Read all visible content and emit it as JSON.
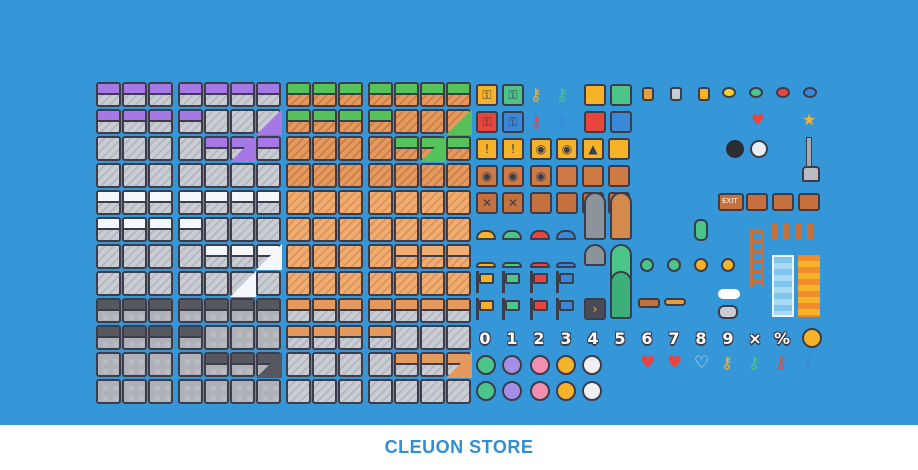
{
  "footer": {
    "store_name": "CLEUON STORE"
  },
  "colors": {
    "background": "#3596d8",
    "outline": "#3c3c4a",
    "purple_cap": "#a678e6",
    "grass": "#55c25a",
    "snow": "#f4f7fb",
    "stone": "#c9ccd2",
    "dirt": "#e49a5e",
    "brand_text": "#2f8fd0"
  },
  "numbers": [
    "0",
    "1",
    "2",
    "3",
    "4",
    "5",
    "6",
    "7",
    "8",
    "9",
    "×",
    "%"
  ],
  "tilesets": [
    {
      "name": "purple-stone-terrain",
      "icon": "purple-stone-tile"
    },
    {
      "name": "grass-dirt-terrain",
      "icon": "grass-dirt-tile"
    },
    {
      "name": "snow-stone-terrain",
      "icon": "snow-stone-tile"
    },
    {
      "name": "cobble-stone-terrain",
      "icon": "cobble-tile"
    }
  ],
  "items": {
    "blocks": [
      "keyhole-block-yellow",
      "keyhole-block-green",
      "key-yellow",
      "key-green",
      "question-block-yellow",
      "block-green",
      "keyhole-block-red",
      "keyhole-block-blue",
      "key-red",
      "key-blue",
      "block-red",
      "block-blue"
    ],
    "collectibles": [
      "gem-orange",
      "gem-silver",
      "gem-gold",
      "balloon-yellow",
      "balloon-green",
      "balloon-red",
      "balloon-blue",
      "heart",
      "star"
    ],
    "hud": [
      "heart-full",
      "heart-half",
      "heart-empty",
      "key-hud-yellow",
      "key-hud-green",
      "key-hud-red",
      "key-hud-blue",
      "coin"
    ],
    "faces": [
      "face-green",
      "face-purple",
      "face-pink",
      "face-yellow",
      "face-white"
    ]
  }
}
